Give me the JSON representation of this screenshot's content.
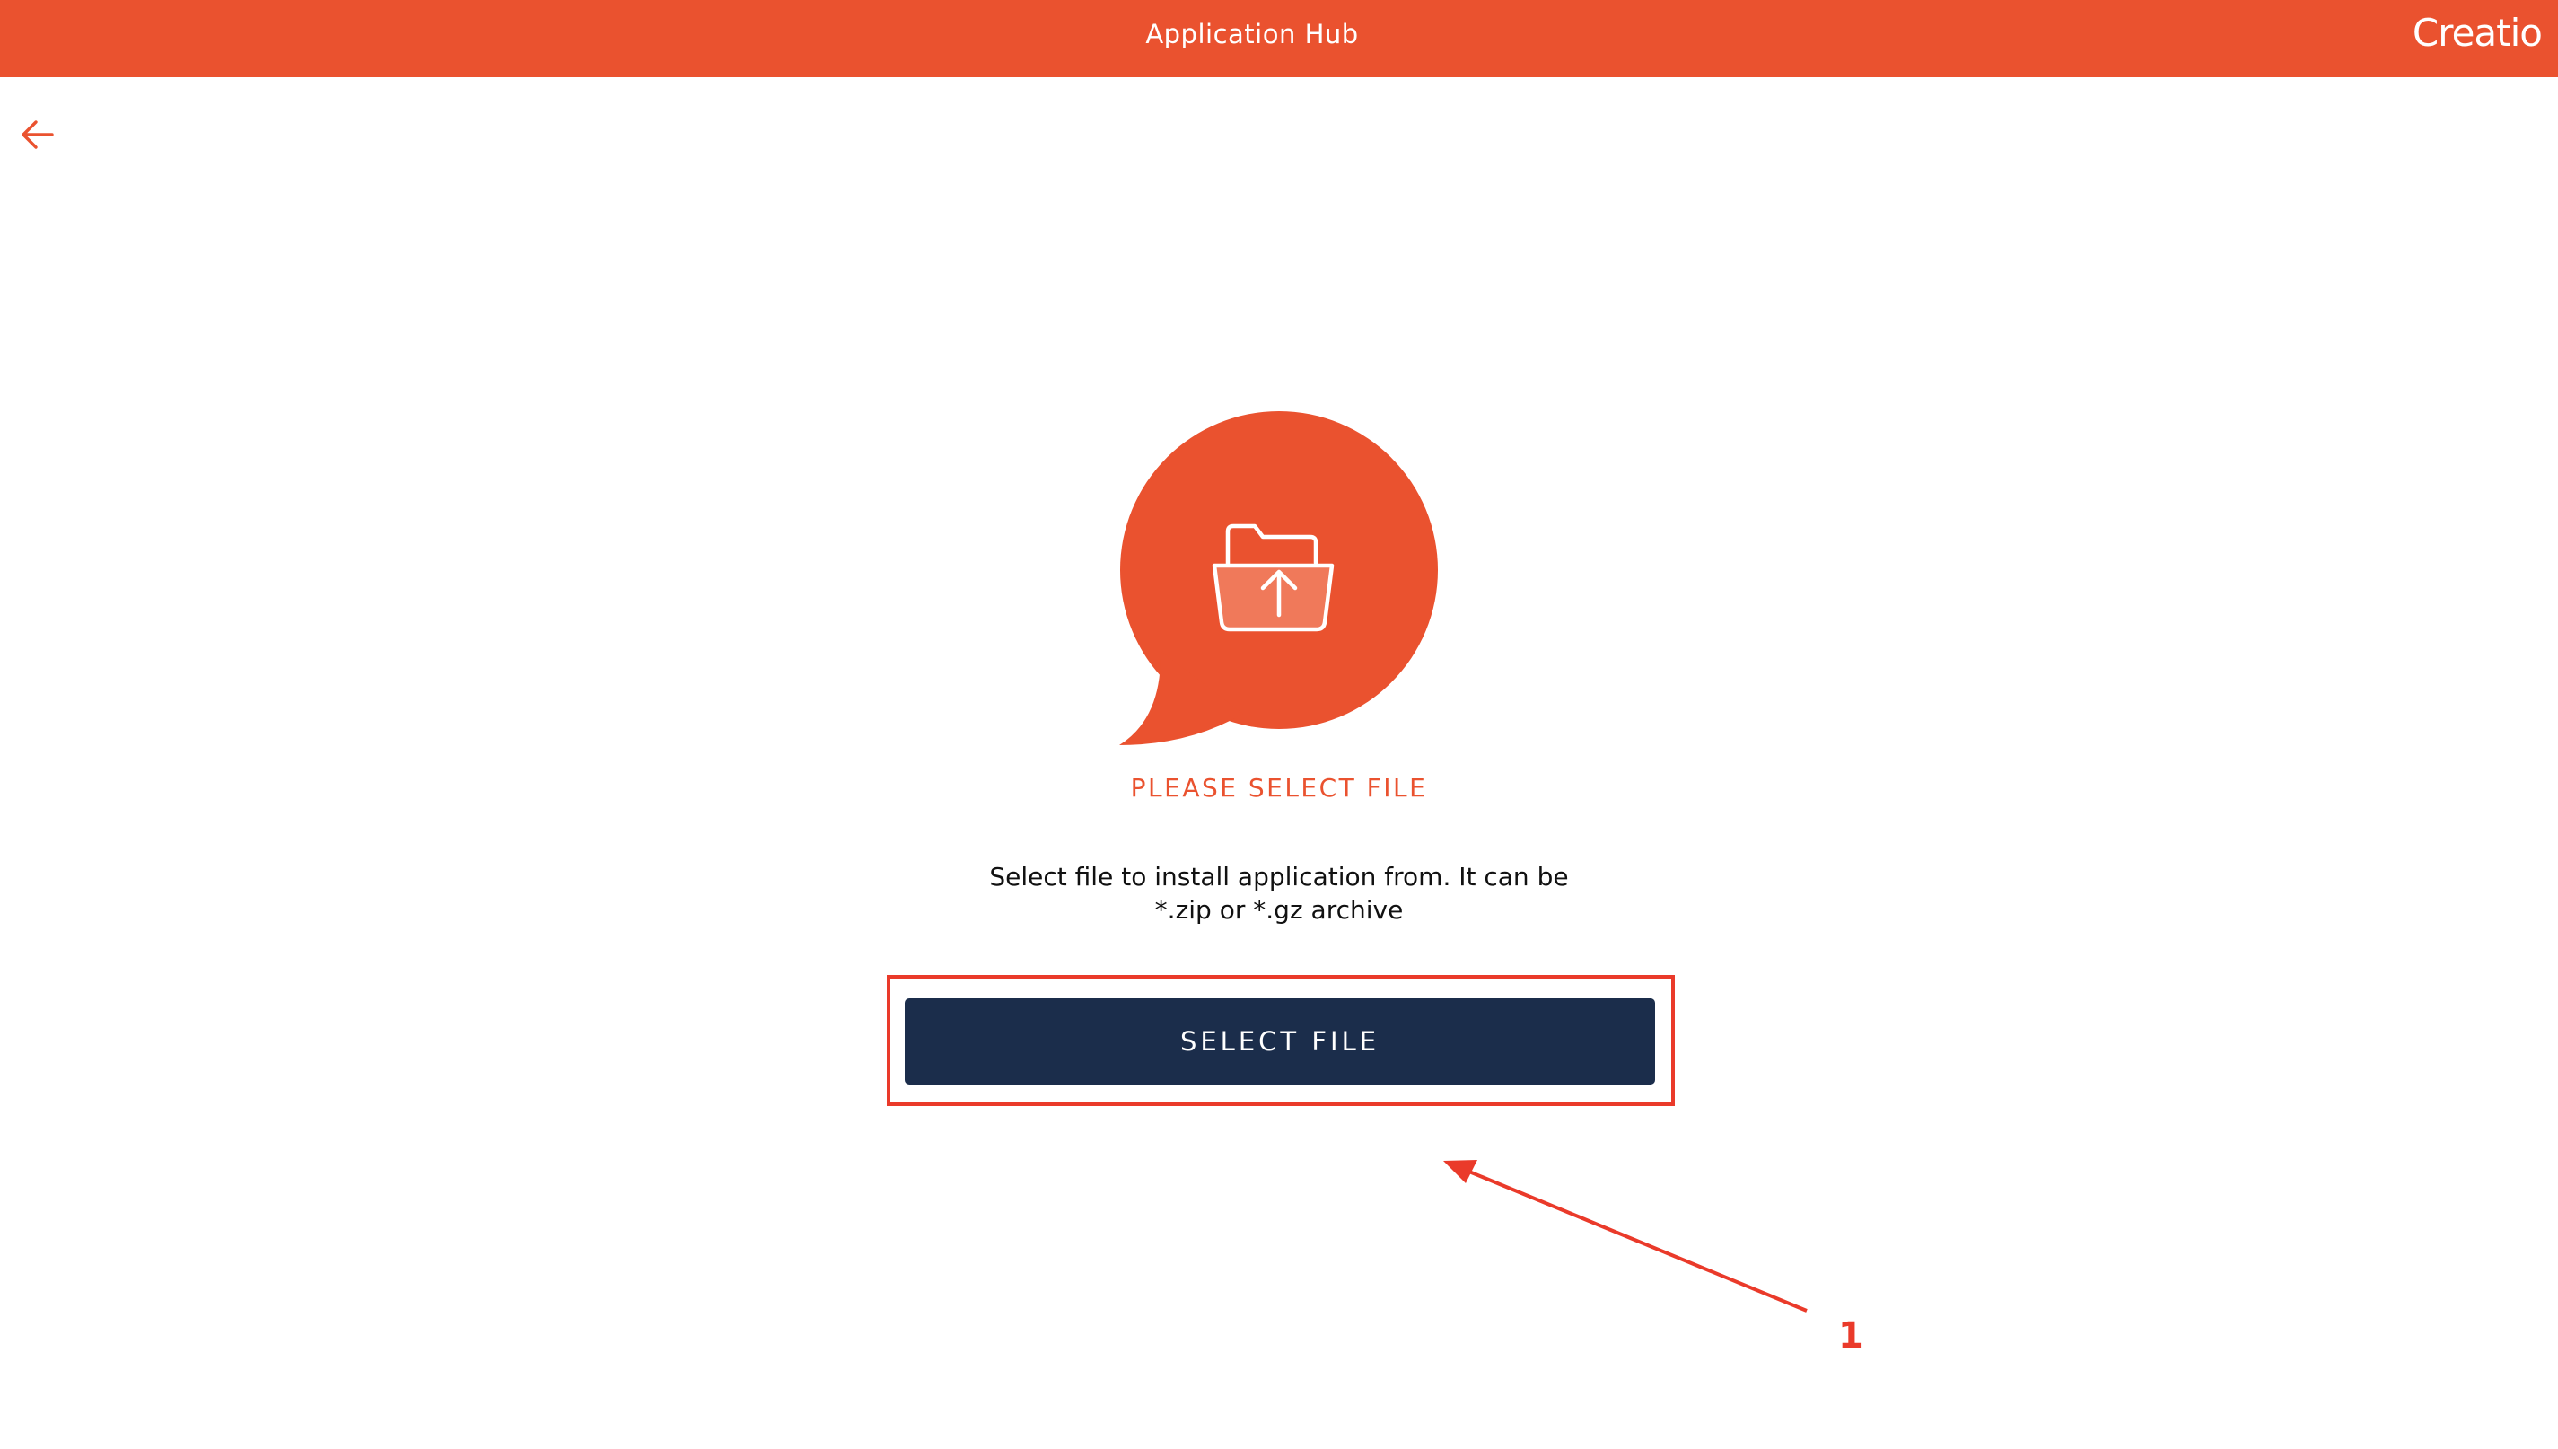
{
  "header": {
    "title": "Application Hub",
    "brand": "Creatio"
  },
  "main": {
    "status_label": "PLEASE SELECT FILE",
    "description": "Select file to install application from. It can be *.zip or *.gz archive",
    "select_button_label": "SELECT FILE"
  },
  "annotation": {
    "number": "1"
  },
  "icons": {
    "back": "arrow-left-icon",
    "upload": "folder-upload-icon"
  },
  "colors": {
    "accent": "#ea522f",
    "button": "#1b2d4b",
    "annotation": "#ea3a2a"
  }
}
